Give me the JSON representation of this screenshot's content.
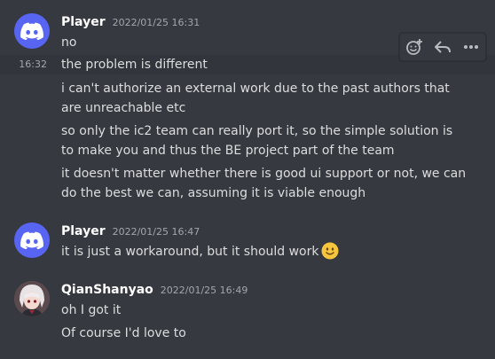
{
  "colors": {
    "background": "#36393f",
    "discord_blurple": "#5865f2",
    "emoji_yellow": "#f8c63d"
  },
  "toolbar": {
    "icons": [
      "add-reaction-icon",
      "reply-icon",
      "more-icon"
    ]
  },
  "messages": [
    {
      "username": "Player",
      "timestamp": "2022/01/25 16:31",
      "avatar": "discord-logo-icon",
      "lines": [
        "no",
        "the problem is different",
        "i can't authorize an external work due to the past authors that",
        "are unreachable etc",
        "so only the ic2 team can really port it, so the simple solution is",
        "to make you and thus the BE project part of the team",
        "it doesn't matter whether there is good ui support or not, we can",
        "do the best we can, assuming it is viable enough"
      ],
      "hover_timestamp": "16:32"
    },
    {
      "username": "Player",
      "timestamp": "2022/01/25 16:47",
      "avatar": "discord-logo-icon",
      "lines": [
        "it is just a workaround, but it should work"
      ],
      "emoji": "slightly-smiling-face-icon"
    },
    {
      "username": "QianShanyao",
      "timestamp": "2022/01/25 16:49",
      "avatar": "anime-avatar",
      "lines": [
        "oh I got it",
        "Of course I'd love to"
      ]
    }
  ]
}
